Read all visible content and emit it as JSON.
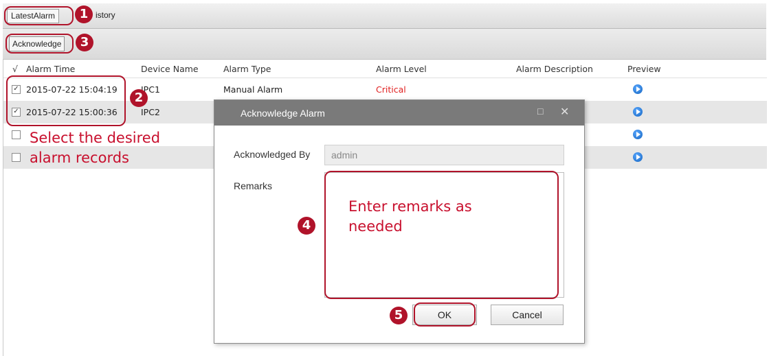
{
  "tabs": {
    "latest_label": "LatestAlarm",
    "history_label": "istory"
  },
  "toolbar": {
    "acknowledge_label": "Acknowledge"
  },
  "table": {
    "headers": {
      "check": "√",
      "alarm_time": "Alarm Time",
      "device_name": "Device Name",
      "alarm_type": "Alarm Type",
      "alarm_level": "Alarm Level",
      "alarm_description": "Alarm Description",
      "preview": "Preview"
    },
    "rows": [
      {
        "checked": "✓",
        "time": "2015-07-22 15:04:19",
        "device": "IPC1",
        "type": "Manual Alarm",
        "level": "Critical",
        "level_color": "#e02020"
      },
      {
        "checked": "✓",
        "time": "2015-07-22 15:00:36",
        "device": "IPC2"
      },
      {
        "checked": ""
      },
      {
        "checked": ""
      }
    ]
  },
  "dialog": {
    "title": "Acknowledge Alarm",
    "maximize_icon": "□",
    "close_icon": "✕",
    "acknowledged_by_label": "Acknowledged By",
    "acknowledged_by_value": "admin",
    "remarks_label": "Remarks",
    "ok_label": "OK",
    "cancel_label": "Cancel"
  },
  "annotations": {
    "step1": "1",
    "step2": "2",
    "step3": "3",
    "step4": "4",
    "step5": "5",
    "select_text_line1": "Select the desired",
    "select_text_line2": "alarm records",
    "remarks_text_line1": "Enter remarks as",
    "remarks_text_line2": "needed",
    "color": "#b0132a"
  }
}
